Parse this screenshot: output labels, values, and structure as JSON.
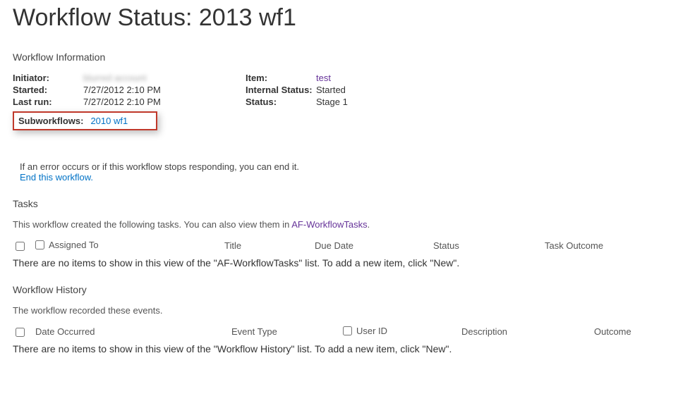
{
  "page_title": "Workflow Status: 2013 wf1",
  "info": {
    "section_title": "Workflow Information",
    "left": {
      "initiator_label": "Initiator:",
      "initiator_value": "blurred account",
      "started_label": "Started:",
      "started_value": "7/27/2012 2:10 PM",
      "lastrun_label": "Last run:",
      "lastrun_value": "7/27/2012 2:10 PM"
    },
    "right": {
      "item_label": "Item:",
      "item_value": "test",
      "internal_label": "Internal Status:",
      "internal_value": "Started",
      "status_label": "Status:",
      "status_value": "Stage 1"
    },
    "subworkflows_label": "Subworkflows:",
    "subworkflows_link": "2010 wf1"
  },
  "error_note": "If an error occurs or if this workflow stops responding, you can end it.",
  "end_link": "End this workflow.",
  "tasks": {
    "title": "Tasks",
    "subtitle_prefix": "This workflow created the following tasks. You can also view them in ",
    "subtitle_link": "AF-WorkflowTasks",
    "subtitle_suffix": ".",
    "columns": {
      "assigned": "Assigned To",
      "title": "Title",
      "due": "Due Date",
      "status": "Status",
      "outcome": "Task Outcome"
    },
    "empty": "There are no items to show in this view of the \"AF-WorkflowTasks\" list. To add a new item, click \"New\"."
  },
  "history": {
    "title": "Workflow History",
    "subtitle": "The workflow recorded these events.",
    "columns": {
      "date": "Date Occurred",
      "etype": "Event Type",
      "uid": "User ID",
      "desc": "Description",
      "outcome": "Outcome"
    },
    "empty": "There are no items to show in this view of the \"Workflow History\" list. To add a new item, click \"New\"."
  }
}
